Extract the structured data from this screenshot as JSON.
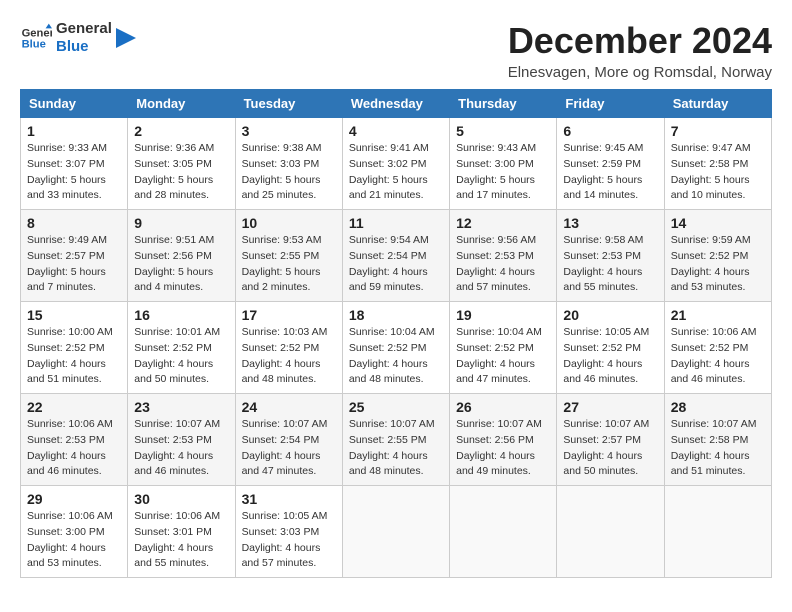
{
  "header": {
    "logo_general": "General",
    "logo_blue": "Blue",
    "main_title": "December 2024",
    "subtitle": "Elnesvagen, More og Romsdal, Norway"
  },
  "calendar": {
    "columns": [
      "Sunday",
      "Monday",
      "Tuesday",
      "Wednesday",
      "Thursday",
      "Friday",
      "Saturday"
    ],
    "weeks": [
      [
        {
          "day": "1",
          "sunrise": "Sunrise: 9:33 AM",
          "sunset": "Sunset: 3:07 PM",
          "daylight": "Daylight: 5 hours and 33 minutes."
        },
        {
          "day": "2",
          "sunrise": "Sunrise: 9:36 AM",
          "sunset": "Sunset: 3:05 PM",
          "daylight": "Daylight: 5 hours and 28 minutes."
        },
        {
          "day": "3",
          "sunrise": "Sunrise: 9:38 AM",
          "sunset": "Sunset: 3:03 PM",
          "daylight": "Daylight: 5 hours and 25 minutes."
        },
        {
          "day": "4",
          "sunrise": "Sunrise: 9:41 AM",
          "sunset": "Sunset: 3:02 PM",
          "daylight": "Daylight: 5 hours and 21 minutes."
        },
        {
          "day": "5",
          "sunrise": "Sunrise: 9:43 AM",
          "sunset": "Sunset: 3:00 PM",
          "daylight": "Daylight: 5 hours and 17 minutes."
        },
        {
          "day": "6",
          "sunrise": "Sunrise: 9:45 AM",
          "sunset": "Sunset: 2:59 PM",
          "daylight": "Daylight: 5 hours and 14 minutes."
        },
        {
          "day": "7",
          "sunrise": "Sunrise: 9:47 AM",
          "sunset": "Sunset: 2:58 PM",
          "daylight": "Daylight: 5 hours and 10 minutes."
        }
      ],
      [
        {
          "day": "8",
          "sunrise": "Sunrise: 9:49 AM",
          "sunset": "Sunset: 2:57 PM",
          "daylight": "Daylight: 5 hours and 7 minutes."
        },
        {
          "day": "9",
          "sunrise": "Sunrise: 9:51 AM",
          "sunset": "Sunset: 2:56 PM",
          "daylight": "Daylight: 5 hours and 4 minutes."
        },
        {
          "day": "10",
          "sunrise": "Sunrise: 9:53 AM",
          "sunset": "Sunset: 2:55 PM",
          "daylight": "Daylight: 5 hours and 2 minutes."
        },
        {
          "day": "11",
          "sunrise": "Sunrise: 9:54 AM",
          "sunset": "Sunset: 2:54 PM",
          "daylight": "Daylight: 4 hours and 59 minutes."
        },
        {
          "day": "12",
          "sunrise": "Sunrise: 9:56 AM",
          "sunset": "Sunset: 2:53 PM",
          "daylight": "Daylight: 4 hours and 57 minutes."
        },
        {
          "day": "13",
          "sunrise": "Sunrise: 9:58 AM",
          "sunset": "Sunset: 2:53 PM",
          "daylight": "Daylight: 4 hours and 55 minutes."
        },
        {
          "day": "14",
          "sunrise": "Sunrise: 9:59 AM",
          "sunset": "Sunset: 2:52 PM",
          "daylight": "Daylight: 4 hours and 53 minutes."
        }
      ],
      [
        {
          "day": "15",
          "sunrise": "Sunrise: 10:00 AM",
          "sunset": "Sunset: 2:52 PM",
          "daylight": "Daylight: 4 hours and 51 minutes."
        },
        {
          "day": "16",
          "sunrise": "Sunrise: 10:01 AM",
          "sunset": "Sunset: 2:52 PM",
          "daylight": "Daylight: 4 hours and 50 minutes."
        },
        {
          "day": "17",
          "sunrise": "Sunrise: 10:03 AM",
          "sunset": "Sunset: 2:52 PM",
          "daylight": "Daylight: 4 hours and 48 minutes."
        },
        {
          "day": "18",
          "sunrise": "Sunrise: 10:04 AM",
          "sunset": "Sunset: 2:52 PM",
          "daylight": "Daylight: 4 hours and 48 minutes."
        },
        {
          "day": "19",
          "sunrise": "Sunrise: 10:04 AM",
          "sunset": "Sunset: 2:52 PM",
          "daylight": "Daylight: 4 hours and 47 minutes."
        },
        {
          "day": "20",
          "sunrise": "Sunrise: 10:05 AM",
          "sunset": "Sunset: 2:52 PM",
          "daylight": "Daylight: 4 hours and 46 minutes."
        },
        {
          "day": "21",
          "sunrise": "Sunrise: 10:06 AM",
          "sunset": "Sunset: 2:52 PM",
          "daylight": "Daylight: 4 hours and 46 minutes."
        }
      ],
      [
        {
          "day": "22",
          "sunrise": "Sunrise: 10:06 AM",
          "sunset": "Sunset: 2:53 PM",
          "daylight": "Daylight: 4 hours and 46 minutes."
        },
        {
          "day": "23",
          "sunrise": "Sunrise: 10:07 AM",
          "sunset": "Sunset: 2:53 PM",
          "daylight": "Daylight: 4 hours and 46 minutes."
        },
        {
          "day": "24",
          "sunrise": "Sunrise: 10:07 AM",
          "sunset": "Sunset: 2:54 PM",
          "daylight": "Daylight: 4 hours and 47 minutes."
        },
        {
          "day": "25",
          "sunrise": "Sunrise: 10:07 AM",
          "sunset": "Sunset: 2:55 PM",
          "daylight": "Daylight: 4 hours and 48 minutes."
        },
        {
          "day": "26",
          "sunrise": "Sunrise: 10:07 AM",
          "sunset": "Sunset: 2:56 PM",
          "daylight": "Daylight: 4 hours and 49 minutes."
        },
        {
          "day": "27",
          "sunrise": "Sunrise: 10:07 AM",
          "sunset": "Sunset: 2:57 PM",
          "daylight": "Daylight: 4 hours and 50 minutes."
        },
        {
          "day": "28",
          "sunrise": "Sunrise: 10:07 AM",
          "sunset": "Sunset: 2:58 PM",
          "daylight": "Daylight: 4 hours and 51 minutes."
        }
      ],
      [
        {
          "day": "29",
          "sunrise": "Sunrise: 10:06 AM",
          "sunset": "Sunset: 3:00 PM",
          "daylight": "Daylight: 4 hours and 53 minutes."
        },
        {
          "day": "30",
          "sunrise": "Sunrise: 10:06 AM",
          "sunset": "Sunset: 3:01 PM",
          "daylight": "Daylight: 4 hours and 55 minutes."
        },
        {
          "day": "31",
          "sunrise": "Sunrise: 10:05 AM",
          "sunset": "Sunset: 3:03 PM",
          "daylight": "Daylight: 4 hours and 57 minutes."
        },
        null,
        null,
        null,
        null
      ]
    ]
  }
}
